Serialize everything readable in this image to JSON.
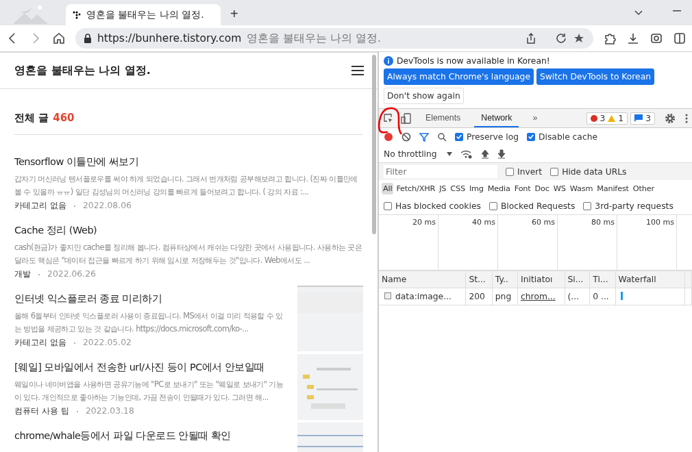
{
  "browser": {
    "tab": {
      "title": "영혼을 불태우는 나의 열정.",
      "selected": true
    },
    "new_tab": "+",
    "address": {
      "url": "https://bunhere.tistory.com",
      "page_title": "영혼을 불태우는 나의 열정."
    }
  },
  "blog": {
    "title": "영혼을 불태우는 나의 열정.",
    "total_label": "전체 글",
    "total_count": "460",
    "posts": [
      {
        "title": "Tensorflow 이틀만에 써보기",
        "excerpt": "갑자기 머신러닝 텐서플로우를 써야 하게 되었습니다. 그래서 번개처럼 공부해보려고 합니다. (진짜 이틀만에 볼 수 있을까 ㅠㅠ) 일단 김성님의 머신러닝 강의를 빠르게 들어보려고 합니다. ( 강의 자료 :...",
        "category": "카테고리 없음",
        "date": "2022.08.06"
      },
      {
        "title": "Cache 정리 (Web)",
        "excerpt": "cash(현금)가 좋지만 cache를 정리해 봅니다. 컴퓨터상에서 캐쉬는 다양한 곳에서 사용됩니다. 사용하는 곳은 달라도 핵심은 \"데이터 접근을 빠르게 하기 위해 임시로 저장해두는 것\"입니다. Web에서도 ...",
        "category": "개발",
        "date": "2022.06.26"
      },
      {
        "title": "인터넷 익스플로러 종료 미리하기",
        "excerpt": "올해 6월부터 인터넷 익스플로러 사용이 종료됩니다. MS에서 이걸 미리 적용할 수 있는 방법을 제공하고 있는 것 같습니다. https://docs.microsoft.com/ko-...",
        "category": "카테고리 없음",
        "date": "2022.05.02"
      },
      {
        "title": "[웨일] 모바일에서 전송한 url/사진 등이 PC에서 안보일때",
        "excerpt": "웨일이나 네이버앱을 사용하면 공유기능에 \"PC로 보내기\" 또는 \"웨일로 보내기\" 기능이 있다. 개인적으로 좋아하는 기능인데, 가끔 전송이 안될때가 있다. 그러면 해...",
        "category": "컴퓨터 사용 팁",
        "date": "2022.03.18"
      },
      {
        "title": "chrome/whale등에서 파일 다운로드 안될때 확인"
      }
    ]
  },
  "devtools": {
    "infobar": {
      "message": "DevTools is now available in Korean!",
      "buttons": [
        {
          "label": "Always match Chrome's language",
          "kind": "primary"
        },
        {
          "label": "Switch DevTools to Korean",
          "kind": "primary"
        },
        {
          "label": "Don't show again",
          "kind": "secondary"
        }
      ]
    },
    "tabs": [
      {
        "label": "Elements",
        "selected": false
      },
      {
        "label": "Network",
        "selected": true
      }
    ],
    "more_tabs": "»",
    "errors": "3",
    "warnings": "1",
    "messages": "3",
    "toolbar": {
      "recording": true,
      "preserve_log": {
        "label": "Preserve log",
        "checked": true
      },
      "disable_cache": {
        "label": "Disable cache",
        "checked": true
      },
      "throttling": "No throttling"
    },
    "filter": {
      "placeholder": "Filter",
      "options": [
        {
          "label": "Invert",
          "checked": false
        },
        {
          "label": "Hide data URLs",
          "checked": false
        }
      ]
    },
    "types": [
      {
        "label": "All",
        "selected": true
      },
      {
        "label": "Fetch/XHR",
        "selected": false
      },
      {
        "label": "JS",
        "selected": false
      },
      {
        "label": "CSS",
        "selected": false
      },
      {
        "label": "Img",
        "selected": false
      },
      {
        "label": "Media",
        "selected": false
      },
      {
        "label": "Font",
        "selected": false
      },
      {
        "label": "Doc",
        "selected": false
      },
      {
        "label": "WS",
        "selected": false
      },
      {
        "label": "Wasm",
        "selected": false
      },
      {
        "label": "Manifest",
        "selected": false
      },
      {
        "label": "Other",
        "selected": false
      }
    ],
    "blocked": [
      {
        "label": "Has blocked cookies",
        "checked": false
      },
      {
        "label": "Blocked Requests",
        "checked": false
      },
      {
        "label": "3rd-party requests",
        "checked": false
      }
    ],
    "timeline_ticks": [
      "20 ms",
      "40 ms",
      "60 ms",
      "80 ms",
      "100 ms"
    ],
    "table": {
      "columns": [
        "Name",
        "St...",
        "Ty..",
        "Initiatoı",
        "Si...",
        "Ti...",
        "Waterfall"
      ],
      "rows": [
        [
          "data:image...",
          "200",
          "png",
          "chrom...",
          "(...",
          "0 ..."
        ]
      ]
    }
  }
}
